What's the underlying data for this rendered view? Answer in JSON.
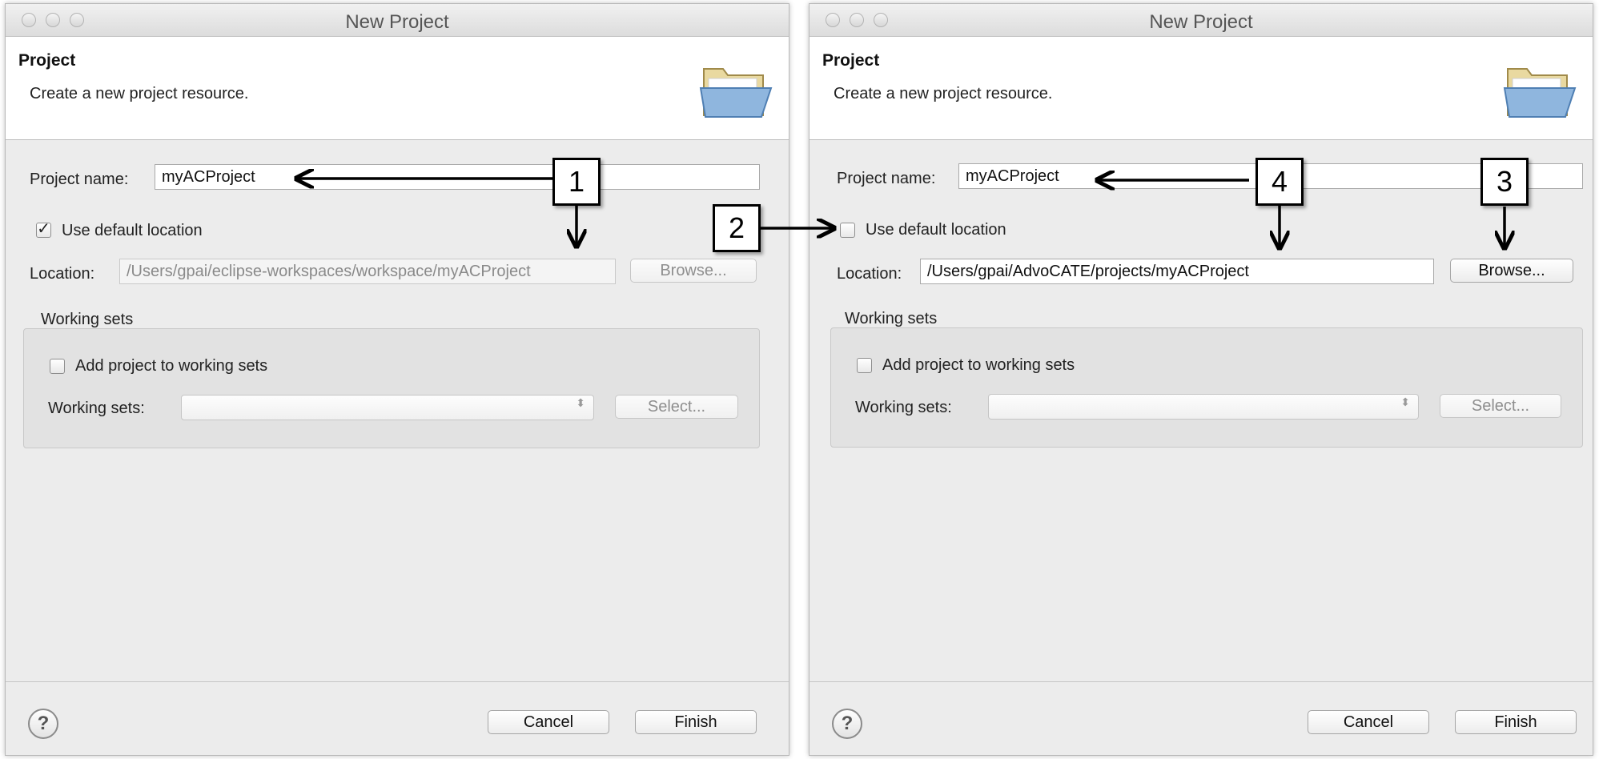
{
  "dialogs": [
    {
      "window_title": "New Project",
      "header_title": "Project",
      "header_description": "Create a new project resource.",
      "project_name_label": "Project name:",
      "project_name_value": "myACProject",
      "use_default_label": "Use default location",
      "use_default_checked": true,
      "location_label": "Location:",
      "location_value": "/Users/gpai/eclipse-workspaces/workspace/myACProject",
      "browse_label": "Browse...",
      "working_sets_group": "Working sets",
      "add_to_working_sets_label": "Add project to working sets",
      "working_sets_label": "Working sets:",
      "select_label": "Select...",
      "cancel_label": "Cancel",
      "finish_label": "Finish",
      "help_glyph": "?"
    },
    {
      "window_title": "New Project",
      "header_title": "Project",
      "header_description": "Create a new project resource.",
      "project_name_label": "Project name:",
      "project_name_value": "myACProject",
      "use_default_label": "Use default location",
      "use_default_checked": false,
      "location_label": "Location:",
      "location_value": "/Users/gpai/AdvoCATE/projects/myACProject",
      "browse_label": "Browse...",
      "working_sets_group": "Working sets",
      "add_to_working_sets_label": "Add project to working sets",
      "working_sets_label": "Working sets:",
      "select_label": "Select...",
      "cancel_label": "Cancel",
      "finish_label": "Finish",
      "help_glyph": "?"
    }
  ],
  "callouts": [
    "1",
    "2",
    "3",
    "4"
  ],
  "checkmark_glyph": "✓",
  "select_arrows_glyph": "⬍",
  "icons": {
    "folder": "folder-icon",
    "help": "help-icon"
  },
  "colors": {
    "window_bg": "#ececec",
    "header_bg": "#ffffff",
    "group_bg": "#e2e2e2",
    "callout_border": "#000000"
  }
}
